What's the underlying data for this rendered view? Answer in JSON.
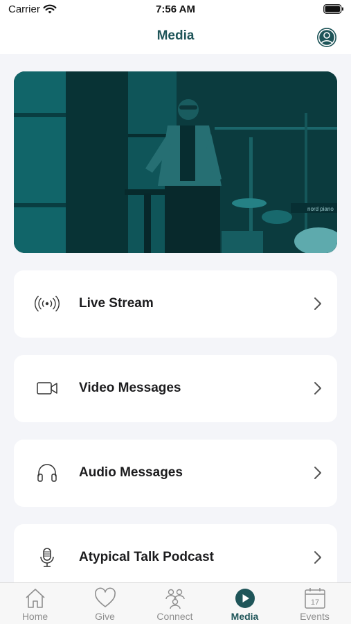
{
  "status_bar": {
    "carrier": "Carrier",
    "time": "7:56 AM",
    "icons": [
      "wifi-icon",
      "battery-icon"
    ]
  },
  "header": {
    "title": "Media",
    "profile_icon": "person-circle-icon"
  },
  "hero": {
    "image": "speaker-on-stage-photo",
    "image_text": "nord piano"
  },
  "menu": [
    {
      "label": "Live Stream",
      "icon": "broadcast-icon"
    },
    {
      "label": "Video Messages",
      "icon": "video-camera-icon"
    },
    {
      "label": "Audio Messages",
      "icon": "headphones-icon"
    },
    {
      "label": "Atypical Talk Podcast",
      "icon": "microphone-icon"
    }
  ],
  "tabs": [
    {
      "label": "Home",
      "icon": "home-icon",
      "active": false
    },
    {
      "label": "Give",
      "icon": "heart-icon",
      "active": false
    },
    {
      "label": "Connect",
      "icon": "people-icon",
      "active": false
    },
    {
      "label": "Media",
      "icon": "play-circle-icon",
      "active": true
    },
    {
      "label": "Events",
      "icon": "calendar-icon",
      "active": false,
      "badge": "17"
    }
  ],
  "colors": {
    "accent": "#1f5559",
    "hero_tint": "#0e5a5e",
    "background": "#f4f5f9",
    "tab_inactive": "#8e8e8e"
  }
}
